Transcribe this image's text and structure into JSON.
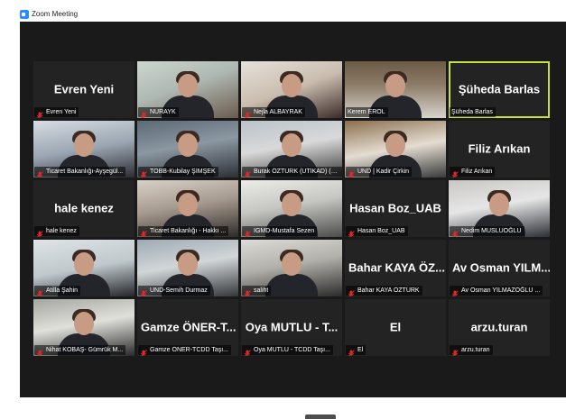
{
  "window": {
    "title": "Zoom Meeting"
  },
  "colors": {
    "active_speaker_border": "#c4e142",
    "meeting_bg": "#1a1a1a",
    "muted_mic": "#e02828"
  },
  "participants": [
    {
      "name": "Evren Yeni",
      "label": "Evren Yeni",
      "video": false,
      "muted": true
    },
    {
      "name": "NURAYK",
      "label": "NURAYK",
      "video": true,
      "muted": true
    },
    {
      "name": "Nejla ALBAYRAK",
      "label": "Nejla ALBAYRAK",
      "video": true,
      "muted": true
    },
    {
      "name": "Kerem EROL",
      "label": "Kerem EROL",
      "video": true,
      "muted": false
    },
    {
      "name": "Şüheda Barlas",
      "label": "Şüheda Barlas",
      "video": false,
      "muted": false,
      "active_speaker": true
    },
    {
      "name": "Ticaret Bakanlığı-Ayşegül",
      "label": "Ticaret Bakanlığı-Ayşegül...",
      "video": true,
      "muted": true
    },
    {
      "name": "TOBB-Kubilay ŞİMŞEK",
      "label": "TOBB-Kubilay ŞİMŞEK",
      "video": true,
      "muted": true
    },
    {
      "name": "Burak ÖZTÜRK (UTİKAD)",
      "label": "Burak ÖZTÜRK (UTİKAD) (Ob...",
      "video": true,
      "muted": true
    },
    {
      "name": "UND | Kadir Çirkin",
      "label": "UND | Kadir Çirkin",
      "video": true,
      "muted": true
    },
    {
      "name": "Filiz Arıkan",
      "label": "Filiz Arıkan",
      "video": false,
      "muted": true
    },
    {
      "name": "hale kenez",
      "label": "hale kenez",
      "video": false,
      "muted": true
    },
    {
      "name": "Ticaret Bakanlığı - Hakkı",
      "label": "Ticaret Bakanlığı - Hakkı ...",
      "video": true,
      "muted": true
    },
    {
      "name": "İGMD-Mustafa Sezen",
      "label": "İGMD-Mustafa Sezen",
      "video": true,
      "muted": true
    },
    {
      "name": "Hasan Boz_UAB",
      "label": "Hasan Boz_UAB",
      "video": false,
      "muted": true
    },
    {
      "name": "Nedim MUSLUOĞLU",
      "label": "Nedim MUSLUOĞLU",
      "video": true,
      "muted": true
    },
    {
      "name": "Atilla Şahin",
      "label": "Atilla Şahin",
      "video": true,
      "muted": true
    },
    {
      "name": "UND-Semih Durmaz",
      "label": "UND-Semih Durmaz",
      "video": true,
      "muted": true
    },
    {
      "name": "saliht",
      "label": "saliht",
      "video": true,
      "muted": true
    },
    {
      "name": "Bahar KAYA ÖZ...",
      "label": "Bahar KAYA ÖZTÜRK",
      "video": false,
      "muted": true
    },
    {
      "name": "Av Osman YILM...",
      "label": "Av Osman YILMAZOĞLU ...",
      "video": false,
      "muted": true
    },
    {
      "name": "Nihat KOBAŞ",
      "label": "Nihat KOBAŞ- Gümrük M...",
      "video": true,
      "muted": true
    },
    {
      "name": "Gamze ÖNER-T...",
      "label": "Gamze ÖNER-TCDD Taşı...",
      "video": false,
      "muted": true
    },
    {
      "name": "Oya MUTLU - T...",
      "label": "Oya MUTLU - TCDD Taşı...",
      "video": false,
      "muted": true
    },
    {
      "name": "El",
      "label": "El",
      "video": false,
      "muted": true
    },
    {
      "name": "arzu.turan",
      "label": "arzu.turan",
      "video": false,
      "muted": true
    }
  ]
}
